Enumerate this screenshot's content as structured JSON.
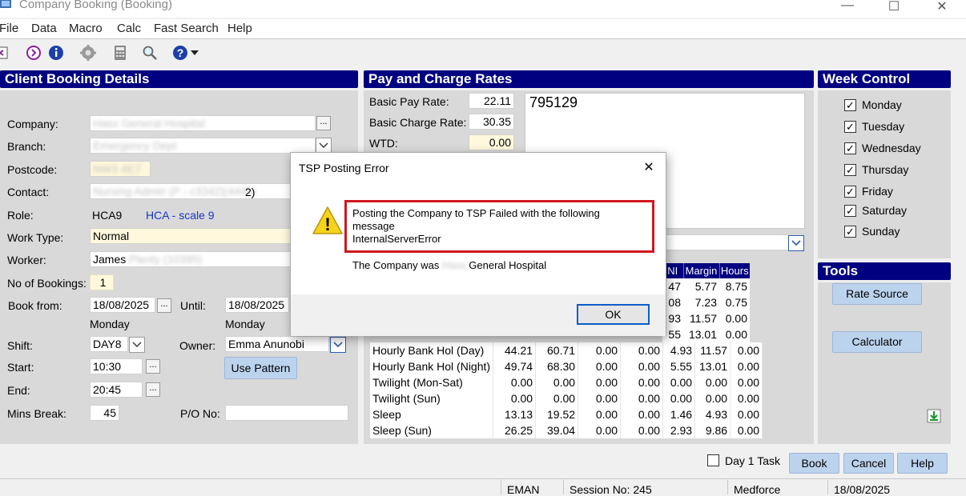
{
  "window": {
    "title": "Company Booking (Booking)"
  },
  "menu": [
    "File",
    "Data",
    "Macro",
    "Calc",
    "Fast Search",
    "Help"
  ],
  "toolbar": {
    "icons": [
      "back-icon",
      "circle-arrow-icon",
      "info-icon",
      "gear-icon",
      "calculator-icon",
      "search-icon",
      "help-icon"
    ]
  },
  "client": {
    "header": "Client Booking Details",
    "labels": {
      "company": "Company:",
      "branch": "Branch:",
      "postcode": "Postcode:",
      "contact": "Contact:",
      "role": "Role:",
      "work_type": "Work Type:",
      "worker": "Worker:",
      "no_bookings": "No of Bookings:",
      "book_from": "Book from:",
      "until": "Until:",
      "shift": "Shift:",
      "owner": "Owner:",
      "start": "Start:",
      "end": "End:",
      "mins_break": "Mins Break:",
      "po_no": "P/O No:"
    },
    "values": {
      "company": "Hasx General Hospital",
      "branch": "Emergency Dept",
      "postcode": "NW3 4E7",
      "contact": "Nursing Admin (P - c3342)(4445)",
      "contact_tail": "2)",
      "role_code": "HCA9",
      "role_desc": "HCA - scale 9",
      "work_type": "Normal",
      "worker_first": "James",
      "worker_rest": "Plenty (10395)",
      "no_bookings": "1",
      "book_from": "18/08/2025",
      "book_from_day": "Monday",
      "until": "18/08/2025",
      "until_day": "Monday",
      "shift": "DAY8",
      "owner": "Emma Anunobi",
      "start": "10:30",
      "end": "20:45",
      "mins_break": "45",
      "po_no": ""
    },
    "use_pattern_label": "Use Pattern",
    "ellipsis": "..."
  },
  "rates": {
    "header": "Pay and Charge Rates",
    "basic_pay_label": "Basic Pay Rate:",
    "basic_pay": "22.11",
    "basic_charge_label": "Basic Charge Rate:",
    "basic_charge": "30.35",
    "wtd_label": "WTD:",
    "wtd": "0.00",
    "notes": "795129",
    "col_headers": [
      "NI",
      "Margin",
      "Hours"
    ],
    "rows_partial": [
      {
        "ni": "47",
        "margin": "5.77",
        "hours": "8.75"
      },
      {
        "ni": "08",
        "margin": "7.23",
        "hours": "0.75"
      },
      {
        "ni": "93",
        "margin": "11.57",
        "hours": "0.00"
      },
      {
        "ni": "55",
        "margin": "13.01",
        "hours": "0.00"
      }
    ],
    "rows": [
      {
        "name": "Hourly Bank Hol (Day)",
        "c1": "44.21",
        "c2": "60.71",
        "c3": "0.00",
        "c4": "0.00",
        "ni": "4.93",
        "margin": "11.57",
        "hours": "0.00"
      },
      {
        "name": "Hourly Bank Hol (Night)",
        "c1": "49.74",
        "c2": "68.30",
        "c3": "0.00",
        "c4": "0.00",
        "ni": "5.55",
        "margin": "13.01",
        "hours": "0.00"
      },
      {
        "name": "Twilight (Mon-Sat)",
        "c1": "0.00",
        "c2": "0.00",
        "c3": "0.00",
        "c4": "0.00",
        "ni": "0.00",
        "margin": "0.00",
        "hours": "0.00"
      },
      {
        "name": "Twilight (Sun)",
        "c1": "0.00",
        "c2": "0.00",
        "c3": "0.00",
        "c4": "0.00",
        "ni": "0.00",
        "margin": "0.00",
        "hours": "0.00"
      },
      {
        "name": "Sleep",
        "c1": "13.13",
        "c2": "19.52",
        "c3": "0.00",
        "c4": "0.00",
        "ni": "1.46",
        "margin": "4.93",
        "hours": "0.00"
      },
      {
        "name": "Sleep (Sun)",
        "c1": "26.25",
        "c2": "39.04",
        "c3": "0.00",
        "c4": "0.00",
        "ni": "2.93",
        "margin": "9.86",
        "hours": "0.00"
      }
    ]
  },
  "week": {
    "header": "Week Control",
    "days": [
      "Monday",
      "Tuesday",
      "Wednesday",
      "Thursday",
      "Friday",
      "Saturday",
      "Sunday"
    ],
    "check_mark": "✓"
  },
  "tools": {
    "header": "Tools",
    "rate_source": "Rate Source",
    "calculator": "Calculator"
  },
  "footer": {
    "day1_task": "Day 1 Task",
    "book": "Book",
    "cancel": "Cancel",
    "help": "Help"
  },
  "status": {
    "user": "EMAN",
    "session": "Session No: 245",
    "company": "Medforce",
    "date": "18/08/2025"
  },
  "dialog": {
    "title": "TSP Posting Error",
    "close": "✕",
    "msg_line1": "Posting the Company to TSP Failed with the following",
    "msg_line2": "message",
    "msg_line3": "InternalServerError",
    "company_prefix": "The Company was",
    "company_blurred": "Hasx",
    "company_suffix": "General Hospital",
    "ok": "OK",
    "warning_glyph": "!"
  },
  "colors": {
    "header_blue": "#000080",
    "button_blue": "#bcd3ee",
    "error_red": "#d0181e",
    "warning_yellow": "#f7d31d"
  }
}
